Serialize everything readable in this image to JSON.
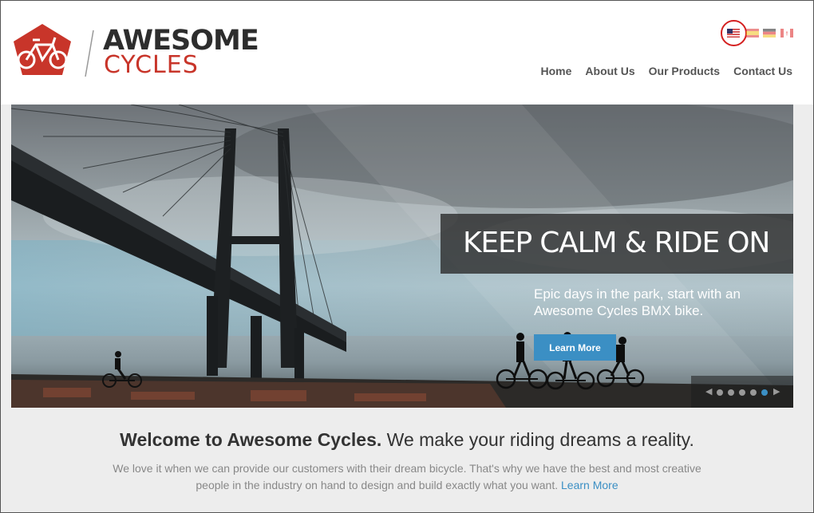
{
  "logo": {
    "top": "AWESOME",
    "bottom": "CYCLES"
  },
  "languages": [
    {
      "icon": "us-flag-icon",
      "selected": true
    },
    {
      "icon": "spain-flag-icon",
      "selected": false
    },
    {
      "icon": "germany-flag-icon",
      "selected": false
    },
    {
      "icon": "canada-flag-icon",
      "selected": false
    }
  ],
  "nav": {
    "home": "Home",
    "about": "About Us",
    "products": "Our Products",
    "contact": "Contact Us"
  },
  "hero": {
    "title": "KEEP CALM & RIDE ON",
    "subtitle": "Epic days in the park, start with an Awesome Cycles BMX bike.",
    "button": "Learn More",
    "slides": 5,
    "active_slide": 5
  },
  "welcome": {
    "bold": "Welcome to Awesome Cycles.",
    "rest": " We make your riding dreams a reality."
  },
  "intro": {
    "text": "We love it when we can provide our customers with their dream bicycle. That's why we have the best and most creative people in the industry on hand to design and build exactly what you want.",
    "link": "Learn More"
  },
  "colors": {
    "brand_red": "#c8352a",
    "accent_blue": "#3b8fc4"
  }
}
